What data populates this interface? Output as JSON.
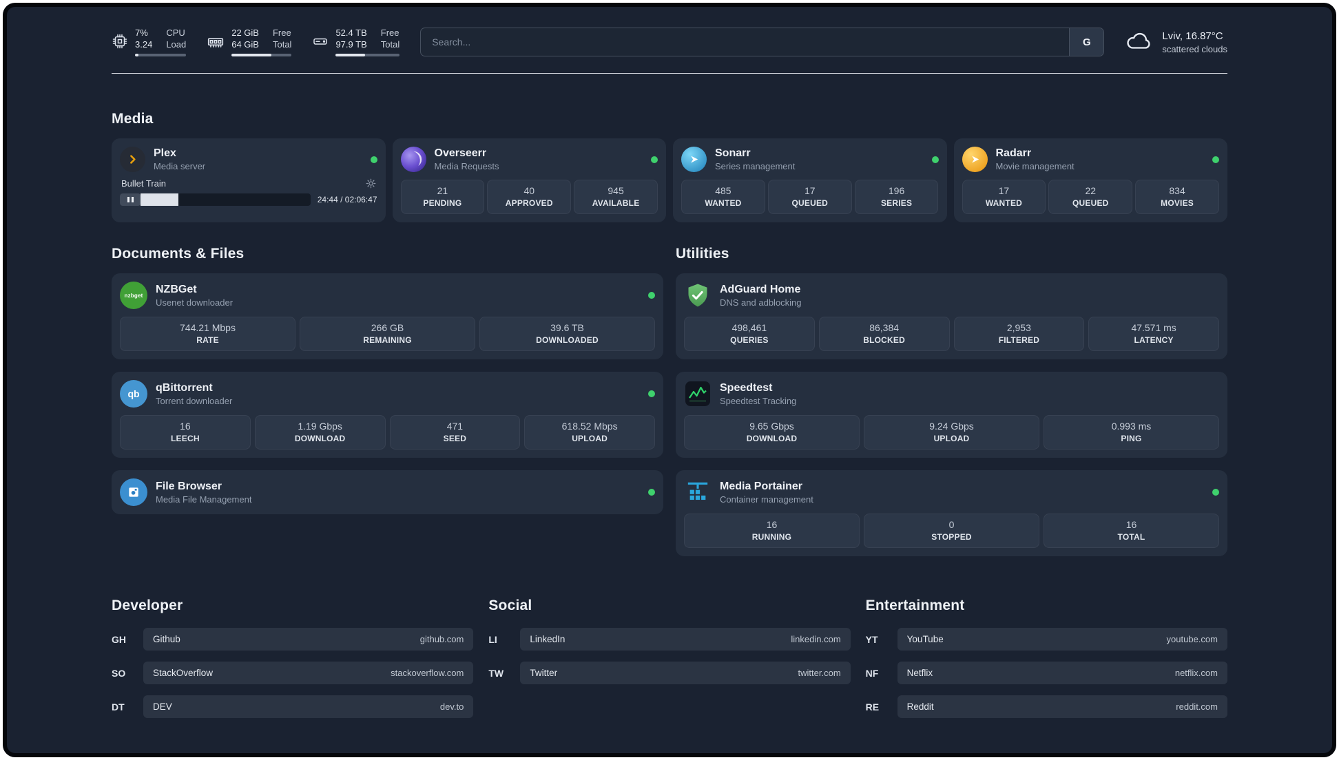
{
  "system": {
    "cpu": {
      "primary": "7%",
      "secondary": "3.24",
      "label_top": "CPU",
      "label_bottom": "Load",
      "percent": 7
    },
    "memory": {
      "primary": "22 GiB",
      "secondary": "64 GiB",
      "label_top": "Free",
      "label_bottom": "Total",
      "percent": 66
    },
    "disk": {
      "primary": "52.4 TB",
      "secondary": "97.9 TB",
      "label_top": "Free",
      "label_bottom": "Total",
      "percent": 46
    }
  },
  "search": {
    "placeholder": "Search...",
    "engine": "G"
  },
  "weather": {
    "location": "Lviv, 16.87°C",
    "condition": "scattered clouds"
  },
  "sections": {
    "media": {
      "title": "Media",
      "apps": [
        {
          "name": "Plex",
          "subtitle": "Media server",
          "online": true,
          "player": {
            "track": "Bullet Train",
            "time": "24:44 / 02:06:47",
            "progress": 20
          }
        },
        {
          "name": "Overseerr",
          "subtitle": "Media Requests",
          "online": true,
          "stats": [
            {
              "value": "21",
              "label": "PENDING"
            },
            {
              "value": "40",
              "label": "APPROVED"
            },
            {
              "value": "945",
              "label": "AVAILABLE"
            }
          ]
        },
        {
          "name": "Sonarr",
          "subtitle": "Series management",
          "online": true,
          "stats": [
            {
              "value": "485",
              "label": "WANTED"
            },
            {
              "value": "17",
              "label": "QUEUED"
            },
            {
              "value": "196",
              "label": "SERIES"
            }
          ]
        },
        {
          "name": "Radarr",
          "subtitle": "Movie management",
          "online": true,
          "stats": [
            {
              "value": "17",
              "label": "WANTED"
            },
            {
              "value": "22",
              "label": "QUEUED"
            },
            {
              "value": "834",
              "label": "MOVIES"
            }
          ]
        }
      ]
    },
    "documents": {
      "title": "Documents & Files",
      "apps": [
        {
          "name": "NZBGet",
          "subtitle": "Usenet downloader",
          "online": true,
          "icon_text": "nzbget",
          "stats": [
            {
              "value": "744.21 Mbps",
              "label": "RATE"
            },
            {
              "value": "266 GB",
              "label": "REMAINING"
            },
            {
              "value": "39.6 TB",
              "label": "DOWNLOADED"
            }
          ]
        },
        {
          "name": "qBittorrent",
          "subtitle": "Torrent downloader",
          "online": true,
          "icon_text": "qb",
          "stats": [
            {
              "value": "16",
              "label": "LEECH"
            },
            {
              "value": "1.19 Gbps",
              "label": "DOWNLOAD"
            },
            {
              "value": "471",
              "label": "SEED"
            },
            {
              "value": "618.52 Mbps",
              "label": "UPLOAD"
            }
          ]
        },
        {
          "name": "File Browser",
          "subtitle": "Media File Management",
          "online": true
        }
      ]
    },
    "utilities": {
      "title": "Utilities",
      "apps": [
        {
          "name": "AdGuard Home",
          "subtitle": "DNS and adblocking",
          "stats": [
            {
              "value": "498,461",
              "label": "QUERIES"
            },
            {
              "value": "86,384",
              "label": "BLOCKED"
            },
            {
              "value": "2,953",
              "label": "FILTERED"
            },
            {
              "value": "47.571 ms",
              "label": "LATENCY"
            }
          ]
        },
        {
          "name": "Speedtest",
          "subtitle": "Speedtest Tracking",
          "stats": [
            {
              "value": "9.65 Gbps",
              "label": "DOWNLOAD"
            },
            {
              "value": "9.24 Gbps",
              "label": "UPLOAD"
            },
            {
              "value": "0.993 ms",
              "label": "PING"
            }
          ]
        },
        {
          "name": "Media Portainer",
          "subtitle": "Container management",
          "online": true,
          "stats": [
            {
              "value": "16",
              "label": "RUNNING"
            },
            {
              "value": "0",
              "label": "STOPPED"
            },
            {
              "value": "16",
              "label": "TOTAL"
            }
          ]
        }
      ]
    }
  },
  "bookmarks": [
    {
      "title": "Developer",
      "links": [
        {
          "tag": "GH",
          "name": "Github",
          "url": "github.com"
        },
        {
          "tag": "SO",
          "name": "StackOverflow",
          "url": "stackoverflow.com"
        },
        {
          "tag": "DT",
          "name": "DEV",
          "url": "dev.to"
        }
      ]
    },
    {
      "title": "Social",
      "links": [
        {
          "tag": "LI",
          "name": "LinkedIn",
          "url": "linkedin.com"
        },
        {
          "tag": "TW",
          "name": "Twitter",
          "url": "twitter.com"
        }
      ]
    },
    {
      "title": "Entertainment",
      "links": [
        {
          "tag": "YT",
          "name": "YouTube",
          "url": "youtube.com"
        },
        {
          "tag": "NF",
          "name": "Netflix",
          "url": "netflix.com"
        },
        {
          "tag": "RE",
          "name": "Reddit",
          "url": "reddit.com"
        }
      ]
    }
  ],
  "colors": {
    "background": "#1a2231",
    "card": "#252f3f",
    "status_online": "#3fd16d",
    "plex_gold": "#e8a00d"
  }
}
